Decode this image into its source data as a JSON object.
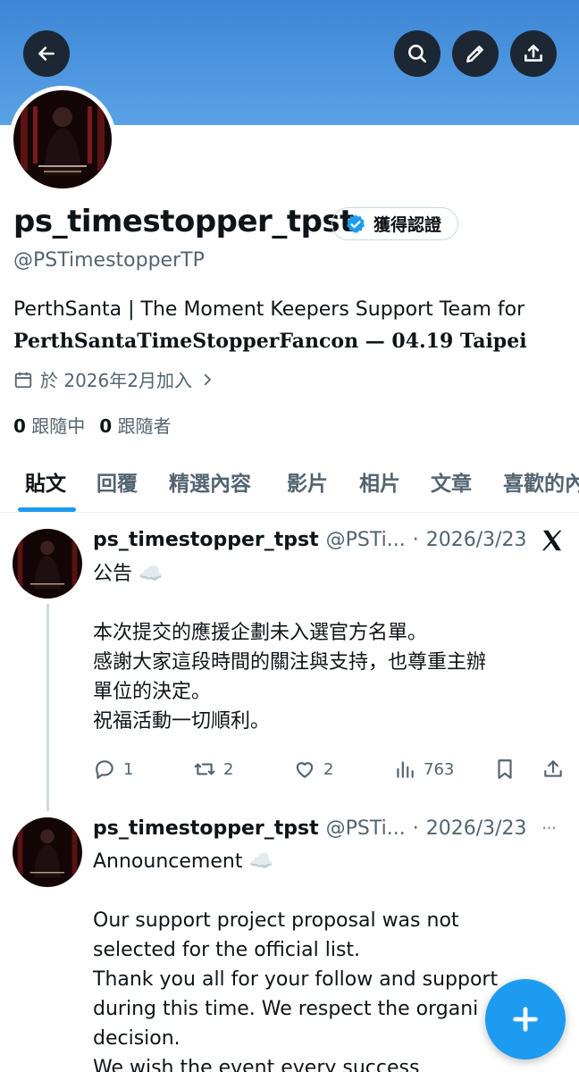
{
  "profile": {
    "name": "ps_timestopper_tpst",
    "handle": "@PSTimestopperTP",
    "verified_label": "獲得認證",
    "bio_line1": "PerthSanta | The Moment Keepers Support Team for",
    "bio_line2": "PerthSantaTimeStopperFancon — 04.19 Taipei",
    "joined": "於 2026年2月加入",
    "following_count": "0",
    "following_label": "跟隨中",
    "followers_count": "0",
    "followers_label": "跟隨者"
  },
  "tabs": [
    "貼文",
    "回覆",
    "精選內容",
    "影片",
    "相片",
    "文章",
    "喜歡的內容"
  ],
  "posts": [
    {
      "name": "ps_timestopper_tpst",
      "handle": "@PSTi...",
      "sep": "·",
      "date": "2026/3/23",
      "title": "公告 ☁️",
      "lines": [
        "本次提交的應援企劃未入選官方名單。",
        "感謝大家這段時間的關注與支持，也尊重主辦",
        "單位的決定。",
        "祝福活動一切順利。"
      ],
      "replies": "1",
      "reposts": "2",
      "likes": "2",
      "views": "763"
    },
    {
      "name": "ps_timestopper_tpst",
      "handle": "@PSTi...",
      "sep": "·",
      "date": "2026/3/23",
      "more": "···",
      "title": "Announcement ☁️",
      "lines": [
        "Our support project proposal was not",
        "selected for the official list.",
        "Thank you all for your follow and support",
        "during this time. We respect the organi",
        "decision.",
        "We wish the event every success"
      ]
    }
  ],
  "colors": {
    "banner": "#4a93de",
    "accent": "#1d9bf0",
    "text": "#0f1419",
    "muted": "#536471"
  },
  "icons": [
    "back-arrow-icon",
    "search-icon",
    "pencil-icon",
    "share-icon",
    "verified-badge-icon",
    "calendar-icon",
    "chevron-right-icon",
    "x-logo-icon",
    "reply-icon",
    "repost-icon",
    "like-icon",
    "views-icon",
    "bookmark-icon",
    "plus-icon"
  ]
}
